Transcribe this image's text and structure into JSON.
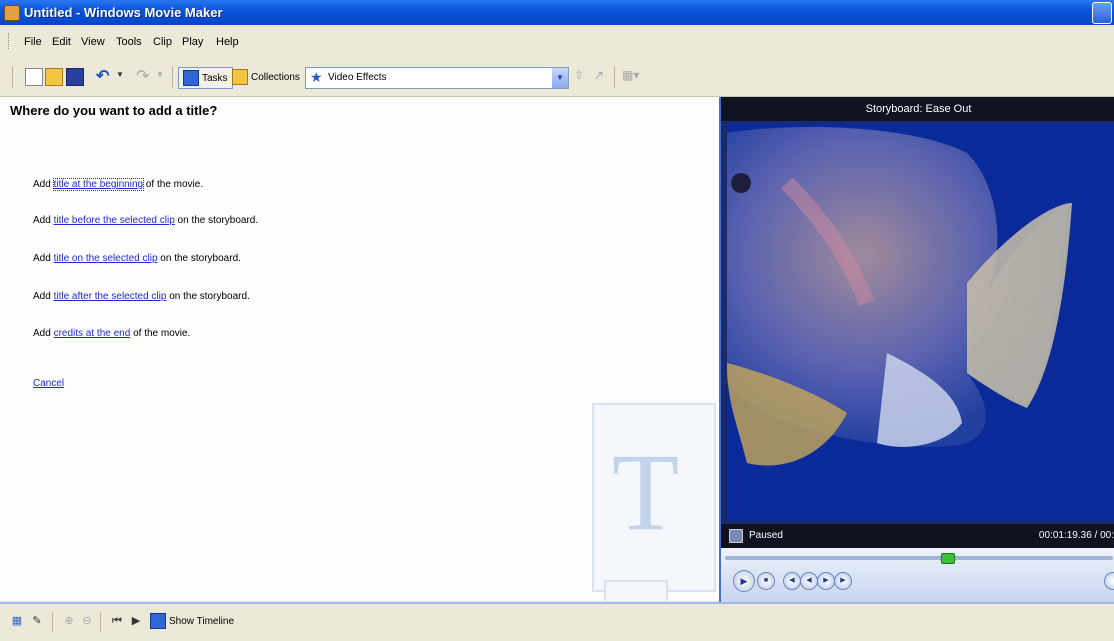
{
  "window": {
    "title": "Untitled - Windows Movie Maker"
  },
  "menu": [
    "File",
    "Edit",
    "View",
    "Tools",
    "Clip",
    "Play",
    "Help"
  ],
  "toolbar": {
    "tasks_label": "Tasks",
    "collections_label": "Collections",
    "collection_select": "Video Effects"
  },
  "task_pane": {
    "heading": "Where do you want to add a title?",
    "options": [
      {
        "prefix": "Add ",
        "link": "title at the beginning",
        "suffix": " of the movie."
      },
      {
        "prefix": "Add ",
        "link": "title before the selected clip",
        "suffix": " on the storyboard."
      },
      {
        "prefix": "Add ",
        "link": "title on the selected clip",
        "suffix": " on the storyboard."
      },
      {
        "prefix": "Add ",
        "link": "title after the selected clip",
        "suffix": " on the storyboard."
      },
      {
        "prefix": "Add ",
        "link": "credits at the end",
        "suffix": " of the movie."
      }
    ],
    "cancel_label": "Cancel",
    "watermark_letter": "T"
  },
  "monitor": {
    "title": "Storyboard: Ease Out",
    "status": "Paused",
    "time": "00:01:19.36 / 00:"
  },
  "bottom": {
    "show_timeline_label": "Show Timeline"
  },
  "colors": {
    "titlebar": "#0a55dd",
    "link": "#1f2ad8",
    "monitor_bg": "#1b2a6a",
    "video_bg": "#0a2b98"
  },
  "icons": [
    "new-project-icon",
    "open-project-icon",
    "save-project-icon",
    "undo-icon",
    "redo-icon",
    "tasks-icon",
    "collections-icon",
    "video-effects-star-icon",
    "storyboard-icon",
    "narrate-icon",
    "zoom-in-icon",
    "zoom-out-icon",
    "rewind-icon",
    "play-timeline-icon"
  ]
}
